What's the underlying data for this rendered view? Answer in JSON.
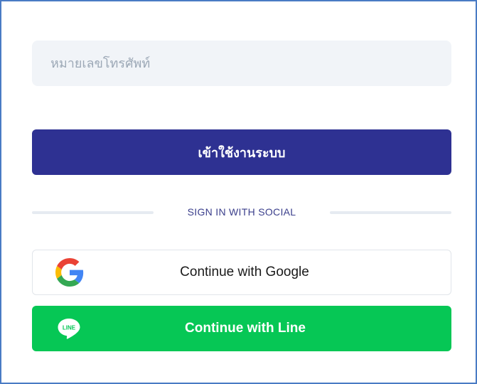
{
  "login_form": {
    "phone_input": {
      "placeholder": "หมายเลขโทรศัพท์",
      "value": ""
    },
    "login_button_label": "เข้าใช้งานระบบ",
    "divider_text": "SIGN IN WITH SOCIAL",
    "google_button": {
      "label": "Continue with Google",
      "icon": "google-logo-icon"
    },
    "line_button": {
      "label": "Continue with Line",
      "icon": "line-logo-icon",
      "icon_text": "LINE"
    }
  },
  "colors": {
    "primary": "#2e3192",
    "line_green": "#06c755",
    "input_background": "#f1f4f8",
    "divider": "#e6ebf1",
    "frame_border": "#4a7bc4"
  }
}
